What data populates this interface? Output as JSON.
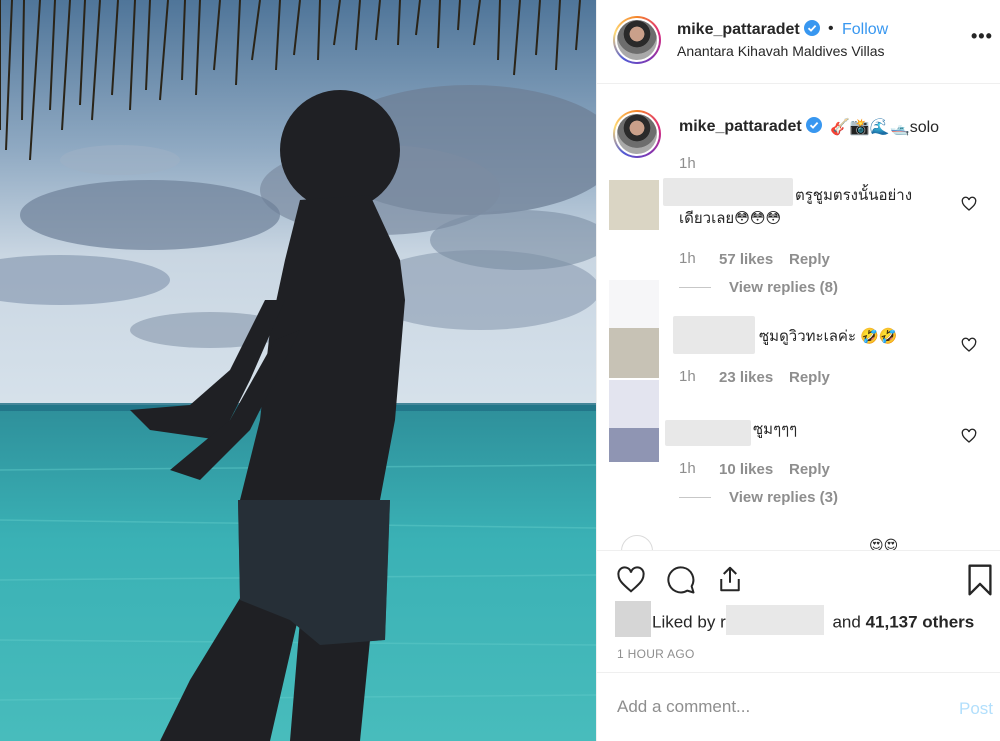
{
  "post": {
    "username": "mike_pattaradet",
    "follow_label": "Follow",
    "separator": "•",
    "location": "Anantara Kihavah Maldives Villas",
    "more": "•••"
  },
  "caption": {
    "username": "mike_pattaradet",
    "text": "🎸📸🌊🛥️solo",
    "time": "1h"
  },
  "comments": [
    {
      "text_line1": "ตรูชูมตรงนั้นอย่าง",
      "text_line2": "เดียวเลย😳😳😳",
      "time": "1h",
      "likes": "57 likes",
      "reply_label": "Reply",
      "view_replies": "View replies (8)"
    },
    {
      "text_line1": "ซูมดูวิวทะเลค่ะ 🤣🤣",
      "time": "1h",
      "likes": "23 likes",
      "reply_label": "Reply"
    },
    {
      "text_line1": "ซูมๆๆๆ",
      "time": "1h",
      "likes": "10 likes",
      "reply_label": "Reply",
      "view_replies": "View replies (3)"
    }
  ],
  "partial_comment": {
    "emoji": "😍😍"
  },
  "likes": {
    "liked_by_prefix": "Liked by",
    "liked_by_initial": "r",
    "and_label": "and",
    "others": "41,137 others"
  },
  "timestamp": "1 HOUR AGO",
  "composer": {
    "placeholder": "Add a comment...",
    "post_label": "Post"
  },
  "colors": {
    "link_blue": "#3897f0",
    "post_disabled": "#b2dffc",
    "muted": "#8e8e8e",
    "text": "#262626"
  },
  "icons": [
    "verified-badge-icon",
    "more-options-icon",
    "heart-icon",
    "comment-icon",
    "share-icon",
    "bookmark-icon"
  ]
}
